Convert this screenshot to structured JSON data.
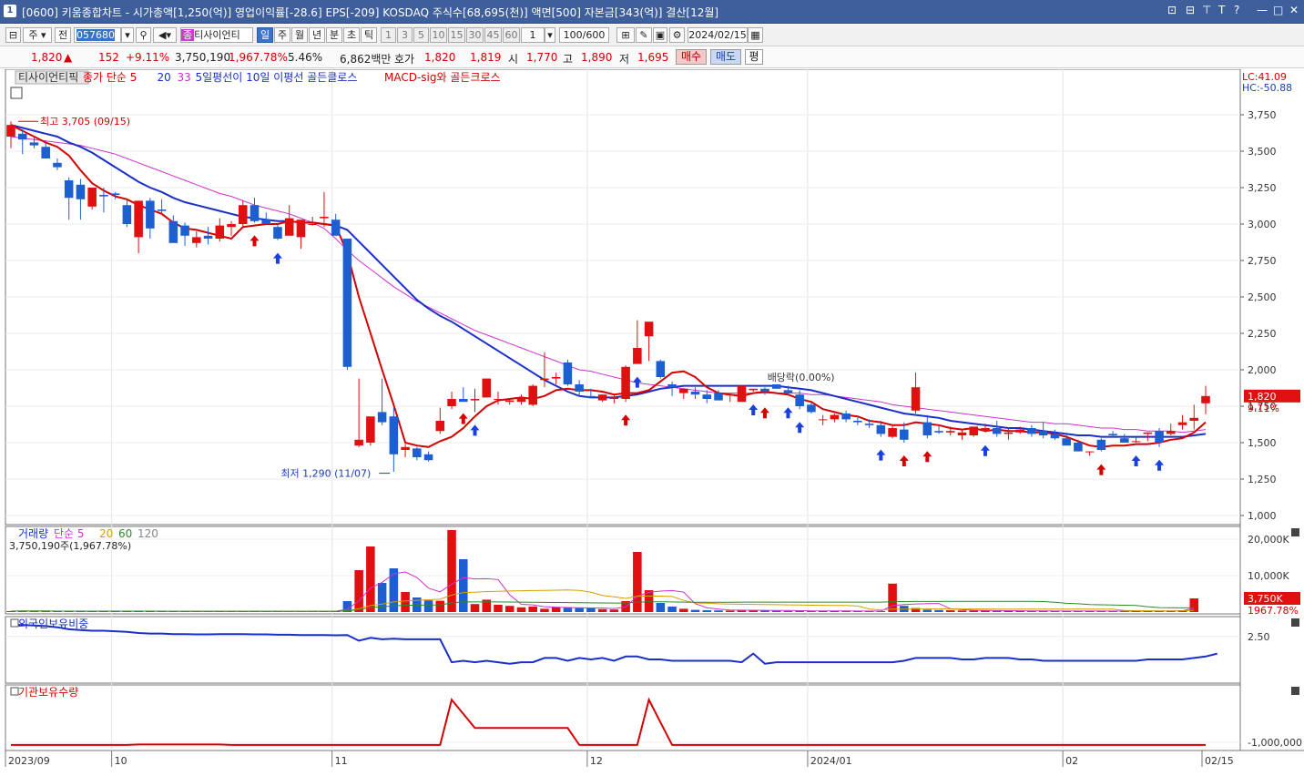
{
  "window": {
    "number": "1",
    "title": "[0600] 키움종합차트 - 시가총액[1,250(억)] 영업이익률[-28.6] EPS[-209] KOSDAQ 주식수[68,695(천)] 액면[500] 자본금[343(억)] 결산[12월]",
    "controls": [
      "⊡",
      "⊟",
      "⊤",
      "T",
      "?",
      "—",
      "□",
      "✕"
    ]
  },
  "toolbar": {
    "period_mode": "주",
    "all_label": "전",
    "stock_code": "057680",
    "stock_name": "티사이언티",
    "intervals": [
      "일",
      "주",
      "월",
      "년",
      "분",
      "초",
      "틱"
    ],
    "selected_interval": "일",
    "minutes": [
      "1",
      "3",
      "5",
      "10",
      "15",
      "30",
      "45",
      "60"
    ],
    "tick_value": "1",
    "count": "100/600",
    "date": "2024/02/15"
  },
  "quote": {
    "price": "1,820",
    "arrow": "▲",
    "change": "152",
    "change_pct": "+9.11%",
    "volume": "3,750,190",
    "volume_ratio": "1,967.78%",
    "turnover": "5.46%",
    "amount": "6,862백만",
    "bid_label": "호가",
    "bid1": "1,820",
    "bid2": "1,819",
    "open_label": "시",
    "open": "1,770",
    "high_label": "고",
    "high": "1,890",
    "low_label": "저",
    "low": "1,695",
    "buy_label": "매수",
    "sell_label": "매도",
    "eval_label": "평"
  },
  "price_panel": {
    "legend": [
      {
        "text": "티사이언티픽",
        "color": "#333333"
      },
      {
        "text": "종가 단순 5",
        "color": "#d40000"
      },
      {
        "text": "20",
        "color": "#1a2fc8"
      },
      {
        "text": "33",
        "color": "#cc33cc"
      },
      {
        "text": "5일평선이 10일 이평선 골든클로스",
        "color": "#1a2fc8"
      },
      {
        "text": "MACD-sig와 골든크로스",
        "color": "#d40000"
      }
    ],
    "lc_label": "LC:41.09",
    "hc_label": "HC:-50.88",
    "high_note": "최고 3,705 (09/15)",
    "low_note": "최저 1,290 (11/07)",
    "dividend_note": "배당락(0.00%)",
    "current_tag": "1,820",
    "current_pct": "9.11%"
  },
  "volume_panel": {
    "legend": [
      {
        "text": "거래량",
        "color": "#1a2fc8"
      },
      {
        "text": "단순 5",
        "color": "#cc33cc"
      },
      {
        "text": "20",
        "color": "#d4a000"
      },
      {
        "text": "60",
        "color": "#2a8a2a"
      },
      {
        "text": "120",
        "color": "#888888"
      }
    ],
    "summary": "3,750,190주(1,967.78%)",
    "current_tag": "3,750K",
    "current_pct": "1967.78%"
  },
  "foreign_panel": {
    "label": "외국인보유비중"
  },
  "inst_panel": {
    "label": "기관보유수량"
  },
  "chart_data": {
    "type": "candlestick",
    "x_labels": [
      {
        "i": 0,
        "text": "2023/09"
      },
      {
        "i": 9,
        "text": "10"
      },
      {
        "i": 28,
        "text": "11"
      },
      {
        "i": 50,
        "text": "12"
      },
      {
        "i": 69,
        "text": "2024/01"
      },
      {
        "i": 91,
        "text": "02"
      },
      {
        "i": 103,
        "text": "02/15"
      }
    ],
    "price_axis": {
      "min": 1000,
      "max": 3750,
      "ticks": [
        3750,
        3500,
        3250,
        3000,
        2750,
        2500,
        2250,
        2000,
        1750,
        1500,
        1250,
        1000
      ],
      "tick_labels": [
        "3,750",
        "3,500",
        "3,250",
        "3,000",
        "2,750",
        "2,500",
        "2,250",
        "2,000",
        "1,750",
        "1,500",
        "1,250",
        "1,000"
      ]
    },
    "volume_axis": {
      "max": 22000,
      "ticks": [
        20000,
        10000
      ],
      "tick_labels": [
        "20,000K",
        "10,000K"
      ]
    },
    "foreign_axis": {
      "min": 1.0,
      "max": 3.0,
      "ticks": [
        2.5
      ],
      "tick_labels": [
        "2.50"
      ]
    },
    "inst_axis": {
      "min": -1100000,
      "max": 100000,
      "ticks": [
        -1000000
      ],
      "tick_labels": [
        "-1,000,000"
      ]
    },
    "candles": [
      [
        3600,
        3705,
        3520,
        3680
      ],
      [
        3620,
        3650,
        3480,
        3580
      ],
      [
        3560,
        3600,
        3520,
        3540
      ],
      [
        3530,
        3560,
        3450,
        3450
      ],
      [
        3420,
        3450,
        3370,
        3390
      ],
      [
        3300,
        3320,
        3030,
        3180
      ],
      [
        3270,
        3310,
        3030,
        3170
      ],
      [
        3120,
        3240,
        3100,
        3250
      ],
      [
        3200,
        3250,
        3080,
        3190
      ],
      [
        3210,
        3220,
        3170,
        3200
      ],
      [
        3130,
        3170,
        2980,
        3000
      ],
      [
        2910,
        3160,
        2800,
        3160
      ],
      [
        3160,
        3180,
        2900,
        2970
      ],
      [
        3100,
        3170,
        3070,
        3090
      ],
      [
        3020,
        3060,
        2920,
        2870
      ],
      [
        2990,
        3010,
        2850,
        2920
      ],
      [
        2870,
        2950,
        2840,
        2910
      ],
      [
        2920,
        2980,
        2860,
        2900
      ],
      [
        2900,
        3040,
        2880,
        2990
      ],
      [
        2980,
        3020,
        2920,
        3000
      ],
      [
        3000,
        3160,
        2980,
        3130
      ],
      [
        3130,
        3180,
        3010,
        3020
      ],
      [
        3030,
        3080,
        3000,
        3000
      ],
      [
        2980,
        3000,
        2890,
        2900
      ],
      [
        2920,
        3130,
        2930,
        3040
      ],
      [
        2910,
        3000,
        2830,
        3030
      ],
      [
        3000,
        3050,
        2990,
        3000
      ],
      [
        3040,
        3220,
        2980,
        3050
      ],
      [
        3030,
        3070,
        2980,
        2920
      ],
      [
        2900,
        2900,
        2000,
        2020
      ],
      [
        1480,
        1940,
        1470,
        1520
      ],
      [
        1500,
        1600,
        1480,
        1680
      ],
      [
        1710,
        1940,
        1620,
        1640
      ],
      [
        1680,
        1740,
        1300,
        1420
      ],
      [
        1450,
        1490,
        1400,
        1470
      ],
      [
        1460,
        1470,
        1380,
        1400
      ],
      [
        1420,
        1440,
        1370,
        1380
      ],
      [
        1580,
        1740,
        1560,
        1650
      ],
      [
        1750,
        1850,
        1730,
        1800
      ],
      [
        1800,
        1880,
        1790,
        1780
      ],
      [
        1790,
        1870,
        1710,
        1800
      ],
      [
        1810,
        1940,
        1810,
        1940
      ],
      [
        1800,
        1850,
        1760,
        1800
      ],
      [
        1780,
        1800,
        1760,
        1790
      ],
      [
        1780,
        1830,
        1760,
        1810
      ],
      [
        1760,
        1900,
        1750,
        1890
      ],
      [
        1930,
        2120,
        1880,
        1940
      ],
      [
        1940,
        1980,
        1900,
        1950
      ],
      [
        2050,
        2070,
        1890,
        1900
      ],
      [
        1900,
        1930,
        1820,
        1850
      ],
      [
        1820,
        1870,
        1810,
        1810
      ],
      [
        1790,
        1830,
        1780,
        1830
      ],
      [
        1800,
        1830,
        1770,
        1810
      ],
      [
        1800,
        2030,
        1780,
        2020
      ],
      [
        2040,
        2340,
        2040,
        2150
      ],
      [
        2230,
        2270,
        2060,
        2330
      ],
      [
        2060,
        2070,
        1940,
        1950
      ],
      [
        1900,
        1920,
        1820,
        1880
      ],
      [
        1840,
        1870,
        1800,
        1870
      ],
      [
        1850,
        1880,
        1800,
        1830
      ],
      [
        1830,
        1860,
        1770,
        1800
      ],
      [
        1840,
        1860,
        1790,
        1790
      ],
      [
        1830,
        1840,
        1780,
        1830
      ],
      [
        1780,
        1890,
        1780,
        1890
      ],
      [
        1860,
        1870,
        1850,
        1870
      ],
      [
        1870,
        1880,
        1830,
        1850
      ],
      [
        1900,
        1890,
        1870,
        1870
      ],
      [
        1860,
        1890,
        1830,
        1840
      ],
      [
        1830,
        1860,
        1730,
        1750
      ],
      [
        1760,
        1780,
        1700,
        1710
      ],
      [
        1660,
        1690,
        1620,
        1660
      ],
      [
        1660,
        1700,
        1640,
        1690
      ],
      [
        1700,
        1720,
        1640,
        1660
      ],
      [
        1650,
        1680,
        1620,
        1640
      ],
      [
        1630,
        1660,
        1600,
        1620
      ],
      [
        1620,
        1650,
        1540,
        1560
      ],
      [
        1540,
        1620,
        1530,
        1600
      ],
      [
        1590,
        1640,
        1500,
        1520
      ],
      [
        1720,
        1980,
        1700,
        1880
      ],
      [
        1640,
        1690,
        1530,
        1550
      ],
      [
        1580,
        1620,
        1560,
        1570
      ],
      [
        1570,
        1610,
        1550,
        1580
      ],
      [
        1550,
        1590,
        1520,
        1570
      ],
      [
        1550,
        1600,
        1540,
        1610
      ],
      [
        1580,
        1630,
        1570,
        1600
      ],
      [
        1600,
        1650,
        1540,
        1560
      ],
      [
        1560,
        1600,
        1520,
        1570
      ],
      [
        1570,
        1610,
        1560,
        1590
      ],
      [
        1600,
        1620,
        1540,
        1560
      ],
      [
        1580,
        1640,
        1530,
        1550
      ],
      [
        1560,
        1590,
        1520,
        1530
      ],
      [
        1530,
        1560,
        1500,
        1480
      ],
      [
        1500,
        1520,
        1440,
        1440
      ],
      [
        1440,
        1440,
        1410,
        1440
      ],
      [
        1520,
        1530,
        1440,
        1450
      ],
      [
        1560,
        1580,
        1540,
        1550
      ],
      [
        1530,
        1560,
        1500,
        1500
      ],
      [
        1510,
        1540,
        1500,
        1510
      ],
      [
        1560,
        1570,
        1510,
        1570
      ],
      [
        1580,
        1600,
        1470,
        1500
      ],
      [
        1560,
        1630,
        1550,
        1580
      ],
      [
        1620,
        1690,
        1590,
        1640
      ],
      [
        1650,
        1760,
        1590,
        1670
      ],
      [
        1770,
        1890,
        1695,
        1820
      ]
    ],
    "ma5_close": [
      3680,
      3640,
      3600,
      3560,
      3530,
      3470,
      3370,
      3280,
      3230,
      3190,
      3170,
      3130,
      3100,
      3070,
      3010,
      2970,
      2960,
      2940,
      2920,
      2900,
      2980,
      2990,
      3000,
      3000,
      3020,
      3010,
      3010,
      3000,
      2990,
      2800,
      2500,
      2250,
      2000,
      1760,
      1500,
      1480,
      1470,
      1510,
      1540,
      1600,
      1680,
      1750,
      1790,
      1800,
      1810,
      1800,
      1820,
      1860,
      1870,
      1860,
      1860,
      1850,
      1830,
      1840,
      1840,
      1860,
      1920,
      1980,
      1990,
      1950,
      1880,
      1840,
      1830,
      1820,
      1840,
      1850,
      1840,
      1830,
      1800,
      1780,
      1730,
      1710,
      1690,
      1680,
      1650,
      1640,
      1620,
      1620,
      1640,
      1630,
      1620,
      1600,
      1590,
      1600,
      1580,
      1590,
      1580,
      1580,
      1570,
      1570,
      1560,
      1540,
      1510,
      1480,
      1470,
      1480,
      1480,
      1490,
      1490,
      1500,
      1520,
      1530,
      1570,
      1640
    ],
    "ma20_close": [
      3680,
      3660,
      3640,
      3620,
      3600,
      3560,
      3530,
      3490,
      3440,
      3390,
      3340,
      3290,
      3250,
      3220,
      3180,
      3150,
      3130,
      3110,
      3090,
      3070,
      3050,
      3040,
      3030,
      3020,
      3020,
      3010,
      3010,
      3000,
      2990,
      2960,
      2880,
      2800,
      2720,
      2640,
      2560,
      2480,
      2420,
      2370,
      2330,
      2280,
      2230,
      2180,
      2130,
      2080,
      2030,
      1980,
      1930,
      1890,
      1850,
      1820,
      1810,
      1810,
      1810,
      1820,
      1830,
      1850,
      1870,
      1880,
      1890,
      1890,
      1890,
      1890,
      1890,
      1890,
      1890,
      1890,
      1890,
      1880,
      1870,
      1860,
      1840,
      1820,
      1800,
      1780,
      1760,
      1740,
      1720,
      1700,
      1690,
      1680,
      1670,
      1650,
      1640,
      1630,
      1620,
      1610,
      1600,
      1600,
      1590,
      1580,
      1570,
      1560,
      1550,
      1550,
      1540,
      1540,
      1540,
      1540,
      1540,
      1540,
      1540,
      1540,
      1550,
      1560
    ],
    "ma33_close": [
      3600,
      3590,
      3580,
      3570,
      3560,
      3550,
      3540,
      3520,
      3500,
      3480,
      3450,
      3420,
      3390,
      3360,
      3330,
      3300,
      3270,
      3240,
      3210,
      3190,
      3160,
      3130,
      3110,
      3090,
      3070,
      3040,
      3010,
      2970,
      2900,
      2820,
      2750,
      2690,
      2630,
      2570,
      2520,
      2470,
      2430,
      2390,
      2350,
      2310,
      2270,
      2240,
      2210,
      2180,
      2150,
      2120,
      2090,
      2060,
      2030,
      2000,
      1990,
      1970,
      1950,
      1930,
      1910,
      1900,
      1890,
      1880,
      1870,
      1860,
      1850,
      1840,
      1840,
      1840,
      1840,
      1840,
      1840,
      1840,
      1840,
      1830,
      1830,
      1820,
      1810,
      1800,
      1790,
      1780,
      1760,
      1750,
      1740,
      1730,
      1720,
      1710,
      1700,
      1690,
      1680,
      1670,
      1660,
      1650,
      1640,
      1640,
      1630,
      1630,
      1620,
      1610,
      1600,
      1600,
      1590,
      1590,
      1580,
      1580,
      1580,
      1570,
      1580,
      1590
    ],
    "buy_signals": [
      21,
      39,
      53,
      65,
      77,
      79,
      94
    ],
    "sell_signals": [
      23,
      40,
      54,
      64,
      67,
      68,
      75,
      84,
      97,
      99
    ],
    "volume_k": [
      260,
      300,
      300,
      200,
      220,
      240,
      200,
      180,
      260,
      230,
      230,
      260,
      220,
      220,
      180,
      200,
      190,
      200,
      220,
      200,
      200,
      210,
      200,
      190,
      210,
      190,
      220,
      240,
      230,
      3000,
      11500,
      18000,
      8000,
      12000,
      5500,
      4000,
      3200,
      3100,
      22500,
      14500,
      2200,
      3400,
      2000,
      1700,
      1300,
      1500,
      900,
      1300,
      1200,
      1100,
      1100,
      800,
      700,
      3000,
      16500,
      6000,
      2500,
      1500,
      900,
      600,
      500,
      450,
      400,
      600,
      500,
      400,
      350,
      300,
      330,
      280,
      300,
      280,
      260,
      250,
      240,
      270,
      7800,
      1700,
      1100,
      650,
      550,
      480,
      420,
      410,
      380,
      350,
      330,
      300,
      280,
      260,
      260,
      300,
      320,
      250,
      280,
      230,
      230,
      250,
      300,
      360,
      280,
      500,
      3750
    ],
    "foreign_pct": [
      2.9,
      2.9,
      2.88,
      2.86,
      2.82,
      2.75,
      2.72,
      2.7,
      2.7,
      2.68,
      2.66,
      2.62,
      2.6,
      2.6,
      2.58,
      2.58,
      2.57,
      2.57,
      2.58,
      2.58,
      2.58,
      2.57,
      2.57,
      2.56,
      2.56,
      2.55,
      2.55,
      2.55,
      2.54,
      2.55,
      2.35,
      2.45,
      2.4,
      2.42,
      2.4,
      2.4,
      2.4,
      2.4,
      1.6,
      1.65,
      1.6,
      1.65,
      1.6,
      1.55,
      1.6,
      1.6,
      1.75,
      1.75,
      1.65,
      1.75,
      1.7,
      1.75,
      1.65,
      1.8,
      1.8,
      1.7,
      1.7,
      1.65,
      1.65,
      1.65,
      1.65,
      1.65,
      1.65,
      1.6,
      1.9,
      1.55,
      1.6,
      1.6,
      1.6,
      1.6,
      1.6,
      1.6,
      1.6,
      1.6,
      1.6,
      1.6,
      1.6,
      1.65,
      1.75,
      1.75,
      1.75,
      1.75,
      1.7,
      1.7,
      1.75,
      1.75,
      1.75,
      1.7,
      1.7,
      1.65,
      1.65,
      1.65,
      1.65,
      1.65,
      1.65,
      1.65,
      1.65,
      1.65,
      1.7,
      1.7,
      1.7,
      1.7,
      1.75,
      1.8,
      1.9
    ],
    "inst_qty": [
      -1060000,
      -1060000,
      -1060000,
      -1060000,
      -1060000,
      -1060000,
      -1060000,
      -1060000,
      -1060000,
      -1060000,
      -1060000,
      -1050000,
      -1050000,
      -1050000,
      -1050000,
      -1050000,
      -1050000,
      -1050000,
      -1050000,
      -1060000,
      -1060000,
      -1060000,
      -1060000,
      -1060000,
      -1060000,
      -1060000,
      -1060000,
      -1060000,
      -1060000,
      -1060000,
      -1060000,
      -1060000,
      -1060000,
      -1060000,
      -1060000,
      -1060000,
      -1060000,
      -1060000,
      -1060000,
      -1060000,
      -1060000,
      -1060000,
      -1060000,
      -1060000,
      -1060000,
      -1060000,
      -1060000,
      -1060000,
      -1060000,
      -1060000,
      -1060000,
      -1060000,
      -1060000,
      -1060000,
      -1060000,
      -1060000,
      -1060000,
      -1060000,
      -1060000,
      -1060000,
      -1060000,
      -1060000,
      -1060000,
      -1060000,
      -1060000,
      -1060000,
      -1060000,
      -1060000,
      -1060000,
      -1060000,
      -1060000,
      -1060000,
      -1060000,
      -1060000,
      -1060000,
      -1060000,
      -1060000,
      -1060000,
      -1060000,
      -1060000,
      -1060000,
      -1060000,
      -1060000,
      -1060000,
      -1060000,
      -1060000,
      -1060000,
      -1060000,
      -1060000,
      -1060000,
      -1060000,
      -1060000,
      -1060000,
      -1060000,
      -1060000,
      -1060000,
      -1060000,
      -1060000,
      -1060000,
      -1060000,
      -1060000,
      -1060000,
      -1060000,
      -1060000
    ],
    "inst_spikes": [
      {
        "from": 37,
        "peak": 38,
        "value": -100000,
        "after": -700000,
        "plateau_end": 48
      },
      {
        "from": 54,
        "peak": 55,
        "value": -100000,
        "after": -1060000,
        "plateau_end": 57
      }
    ]
  }
}
